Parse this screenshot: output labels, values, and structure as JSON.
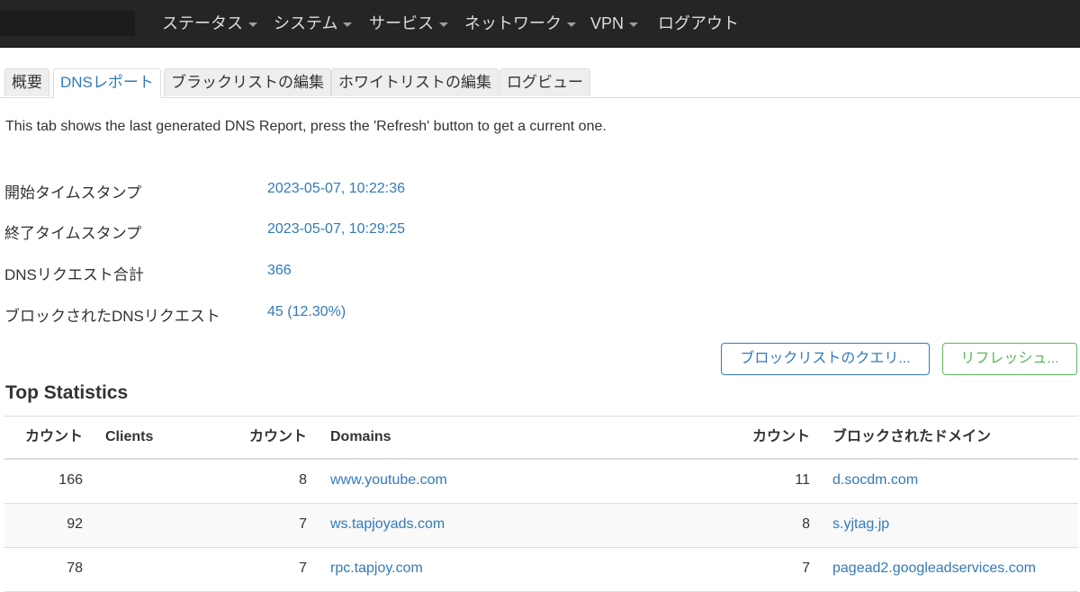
{
  "navbar": {
    "items": [
      {
        "label": "ステータス",
        "dropdown": true
      },
      {
        "label": "システム",
        "dropdown": true
      },
      {
        "label": "サービス",
        "dropdown": true
      },
      {
        "label": "ネットワーク",
        "dropdown": true
      },
      {
        "label": "VPN",
        "dropdown": true
      },
      {
        "label": "ログアウト",
        "dropdown": false
      }
    ]
  },
  "tabs": [
    {
      "label": "概要",
      "active": false
    },
    {
      "label": "DNSレポート",
      "active": true
    },
    {
      "label": "ブラックリストの編集",
      "active": false
    },
    {
      "label": "ホワイトリストの編集",
      "active": false
    },
    {
      "label": "ログビュー",
      "active": false
    }
  ],
  "intro": "This tab shows the last generated DNS Report, press the 'Refresh' button to get a current one.",
  "report": [
    {
      "label": "開始タイムスタンプ",
      "value": "2023-05-07, 10:22:36"
    },
    {
      "label": "終了タイムスタンプ",
      "value": "2023-05-07, 10:29:25"
    },
    {
      "label": "DNSリクエスト合計",
      "value": "366"
    },
    {
      "label": "ブロックされたDNSリクエスト",
      "value": "45 (12.30%)"
    }
  ],
  "buttons": {
    "query_blocklist": "ブロックリストのクエリ...",
    "refresh": "リフレッシュ..."
  },
  "section_title": "Top Statistics",
  "stats": {
    "headers": {
      "count1": "カウント",
      "clients": "Clients",
      "count2": "カウント",
      "domains": "Domains",
      "count3": "カウント",
      "blocked_domains": "ブロックされたドメイン"
    },
    "rows": [
      {
        "client_count": "166",
        "client": "",
        "domain_count": "8",
        "domain": "www.youtube.com",
        "blocked_count": "11",
        "blocked_domain": "d.socdm.com"
      },
      {
        "client_count": "92",
        "client": "",
        "domain_count": "7",
        "domain": "ws.tapjoyads.com",
        "blocked_count": "8",
        "blocked_domain": "s.yjtag.jp"
      },
      {
        "client_count": "78",
        "client": "",
        "domain_count": "7",
        "domain": "rpc.tapjoy.com",
        "blocked_count": "7",
        "blocked_domain": "pagead2.googleadservices.com"
      }
    ]
  }
}
